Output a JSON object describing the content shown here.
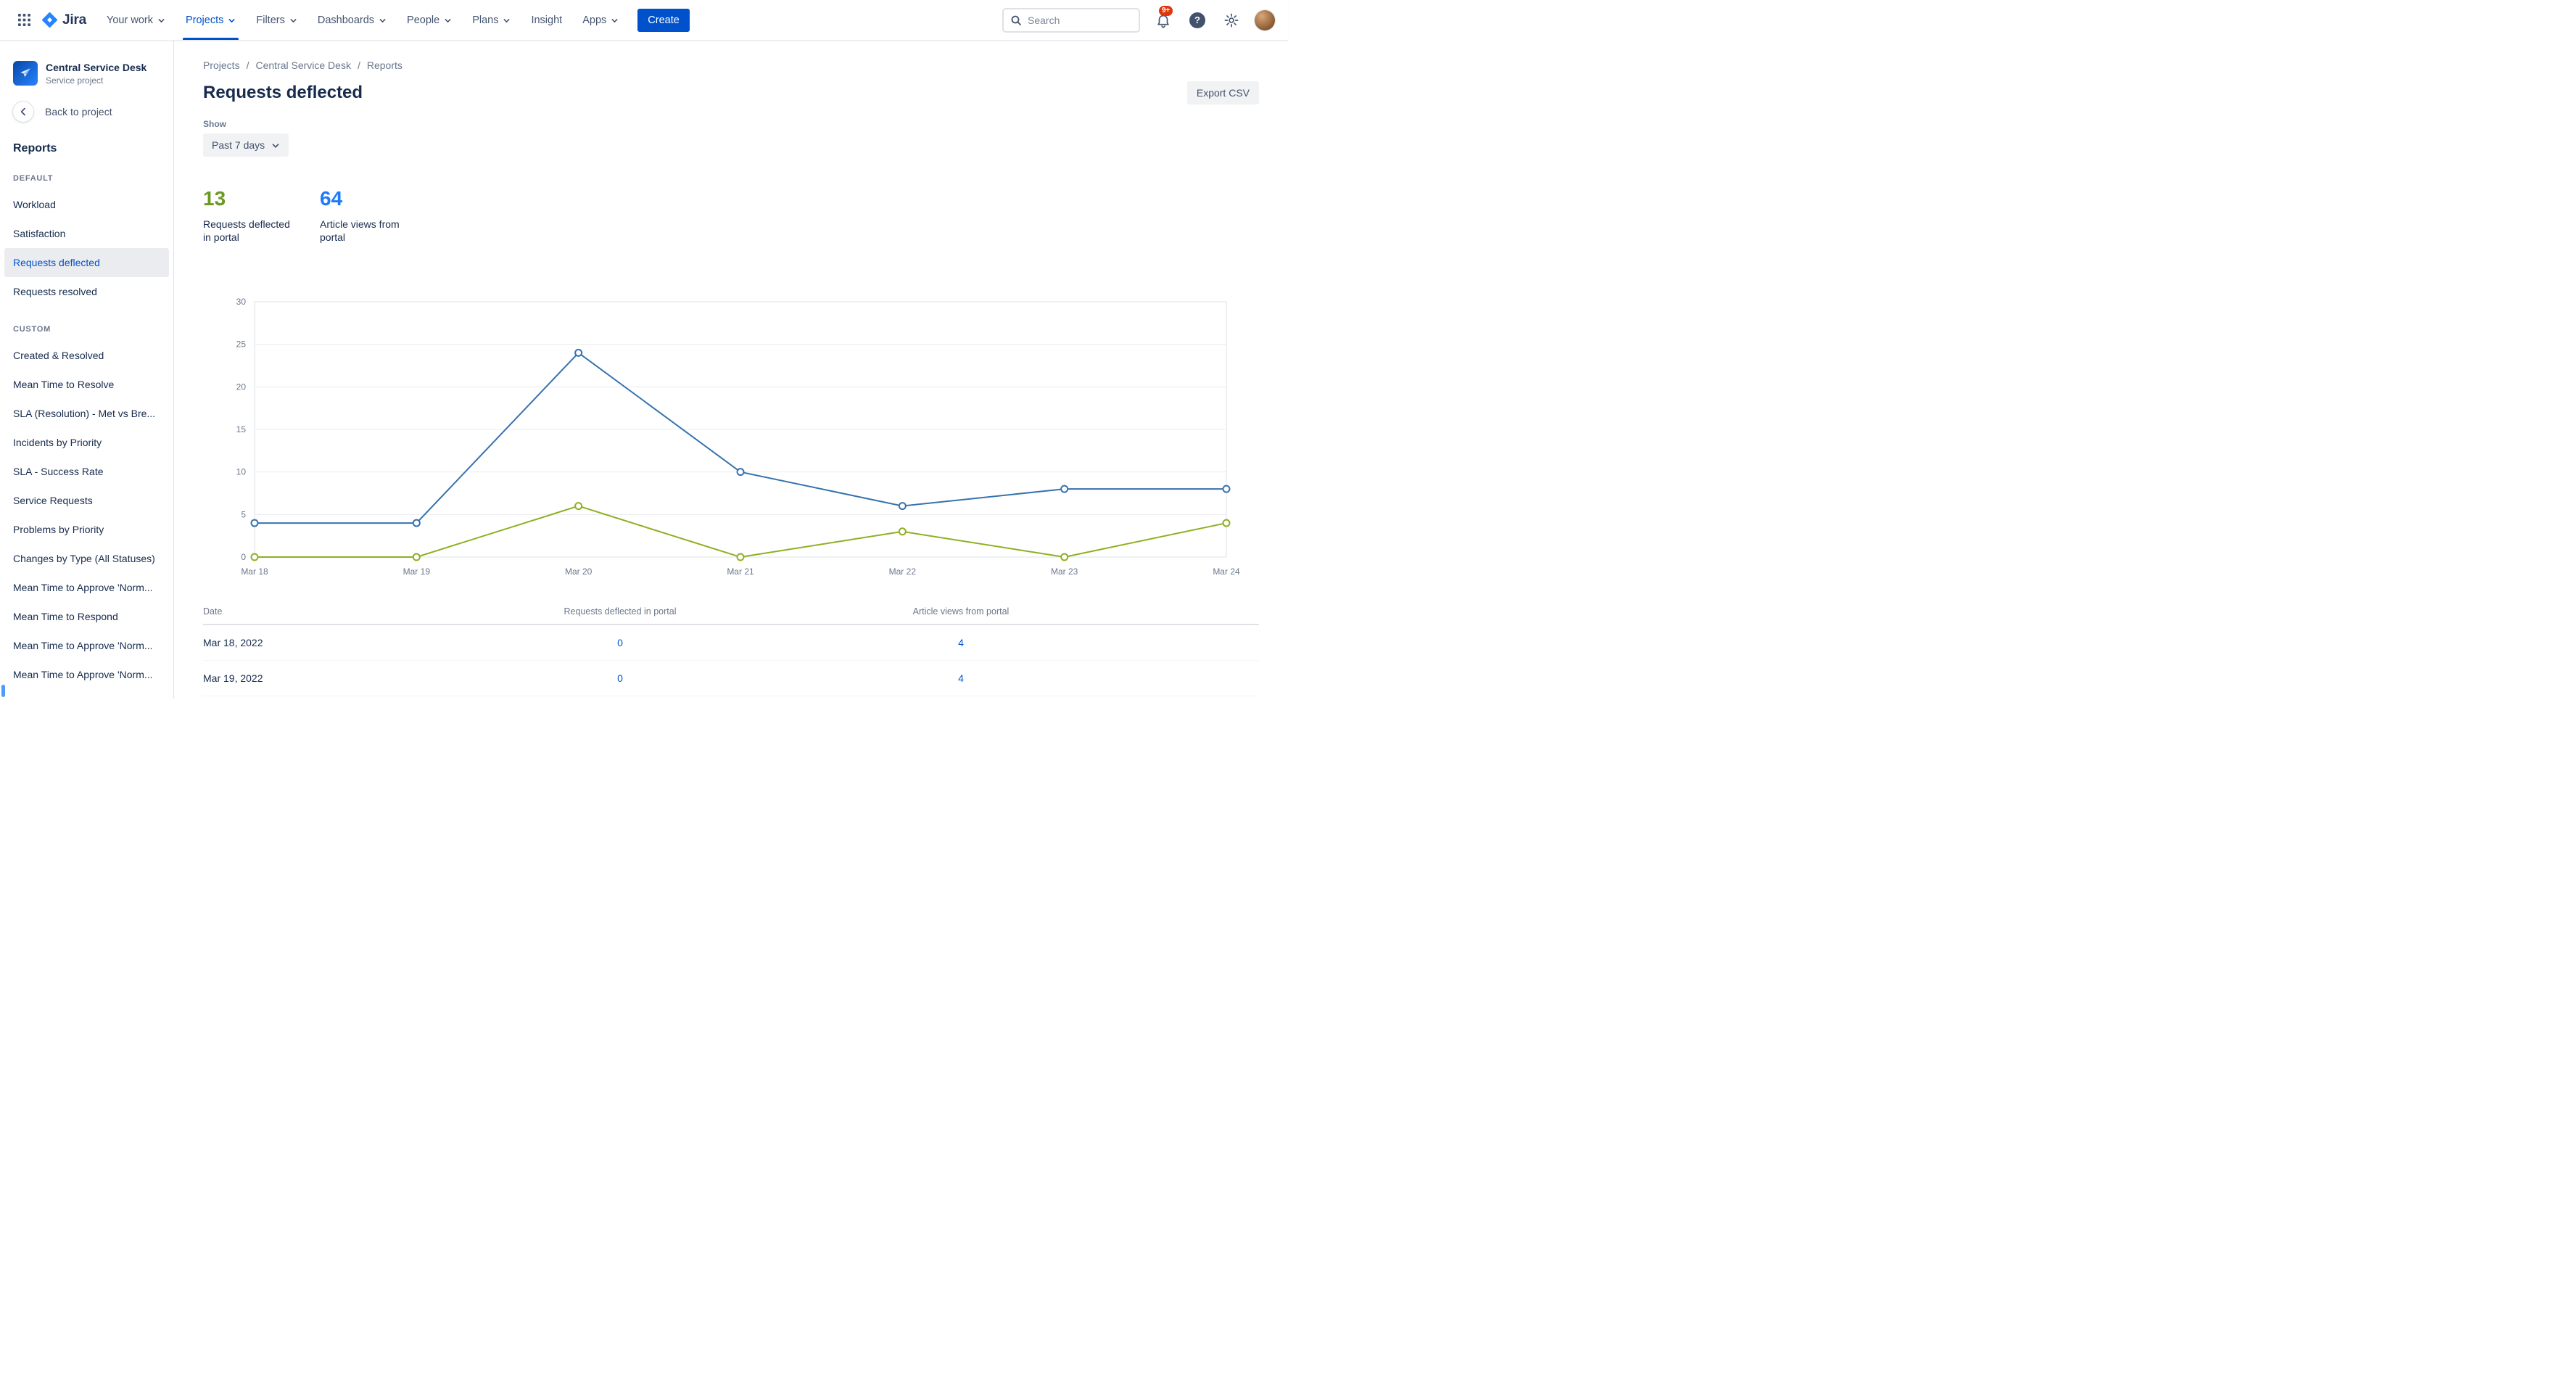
{
  "topnav": {
    "logo_text": "Jira",
    "items": [
      {
        "label": "Your work",
        "chevron": true
      },
      {
        "label": "Projects",
        "chevron": true,
        "active": true
      },
      {
        "label": "Filters",
        "chevron": true
      },
      {
        "label": "Dashboards",
        "chevron": true
      },
      {
        "label": "People",
        "chevron": true
      },
      {
        "label": "Plans",
        "chevron": true
      },
      {
        "label": "Insight",
        "chevron": false
      },
      {
        "label": "Apps",
        "chevron": true
      }
    ],
    "create_label": "Create",
    "search_placeholder": "Search",
    "notification_badge": "9+",
    "help_glyph": "?"
  },
  "sidebar": {
    "project_name": "Central Service Desk",
    "project_type": "Service project",
    "back_label": "Back to project",
    "section_title": "Reports",
    "groups": [
      {
        "heading": "DEFAULT",
        "items": [
          {
            "label": "Workload"
          },
          {
            "label": "Satisfaction"
          },
          {
            "label": "Requests deflected",
            "active": true
          },
          {
            "label": "Requests resolved"
          }
        ]
      },
      {
        "heading": "CUSTOM",
        "items": [
          {
            "label": "Created & Resolved"
          },
          {
            "label": "Mean Time to Resolve"
          },
          {
            "label": "SLA (Resolution) - Met vs Bre..."
          },
          {
            "label": "Incidents by Priority"
          },
          {
            "label": "SLA - Success Rate"
          },
          {
            "label": "Service Requests"
          },
          {
            "label": "Problems by Priority"
          },
          {
            "label": "Changes by Type (All Statuses)"
          },
          {
            "label": "Mean Time to Approve 'Norm..."
          },
          {
            "label": "Mean Time to Respond"
          },
          {
            "label": "Mean Time to Approve 'Norm..."
          },
          {
            "label": "Mean Time to Approve 'Norm..."
          }
        ]
      }
    ]
  },
  "main": {
    "breadcrumb": [
      "Projects",
      "Central Service Desk",
      "Reports"
    ],
    "breadcrumb_separator": "/",
    "title": "Requests deflected",
    "export_label": "Export CSV",
    "show_label": "Show",
    "filter_value": "Past 7 days",
    "stats": [
      {
        "value": "13",
        "label": "Requests deflected in portal",
        "color": "#6A9A23"
      },
      {
        "value": "64",
        "label": "Article views from portal",
        "color": "#1D7AFC"
      }
    ]
  },
  "chart_data": {
    "type": "line",
    "title": "Requests deflected - past 7 days",
    "x": [
      "Mar 18",
      "Mar 19",
      "Mar 20",
      "Mar 21",
      "Mar 22",
      "Mar 23",
      "Mar 24"
    ],
    "series": [
      {
        "name": "Article views from portal",
        "color": "#3572B0",
        "values": [
          4,
          4,
          24,
          10,
          6,
          8,
          8
        ]
      },
      {
        "name": "Requests deflected in portal",
        "color": "#8EB021",
        "values": [
          0,
          0,
          6,
          0,
          3,
          0,
          4
        ]
      }
    ],
    "ylim": [
      0,
      30
    ],
    "yticks": [
      0,
      5,
      10,
      15,
      20,
      25,
      30
    ],
    "grid": true,
    "legend": "none",
    "xlabel": "",
    "ylabel": ""
  },
  "table": {
    "columns": [
      "Date",
      "Requests deflected in portal",
      "Article views from portal"
    ],
    "rows": [
      {
        "date": "Mar 18, 2022",
        "deflected": "0",
        "views": "4"
      },
      {
        "date": "Mar 19, 2022",
        "deflected": "0",
        "views": "4"
      }
    ]
  }
}
